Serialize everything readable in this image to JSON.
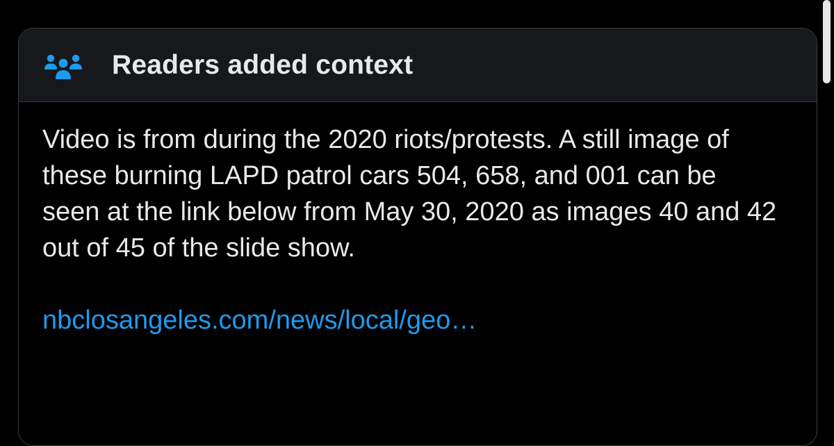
{
  "header": {
    "icon": "people-icon",
    "title": "Readers added context"
  },
  "body": {
    "text": "Video is from during the 2020 riots/protests. A still image of these burning LAPD patrol cars 504, 658, and 001 can be seen at the link below from May 30, 2020 as images 40 and 42 out of 45 of the slide show.",
    "link_text": "nbclosangeles.com/news/local/geo…"
  },
  "colors": {
    "background": "#000000",
    "header_background": "#16181c",
    "text": "#e7e9ea",
    "link": "#1d9bf0",
    "icon": "#1d9bf0"
  }
}
